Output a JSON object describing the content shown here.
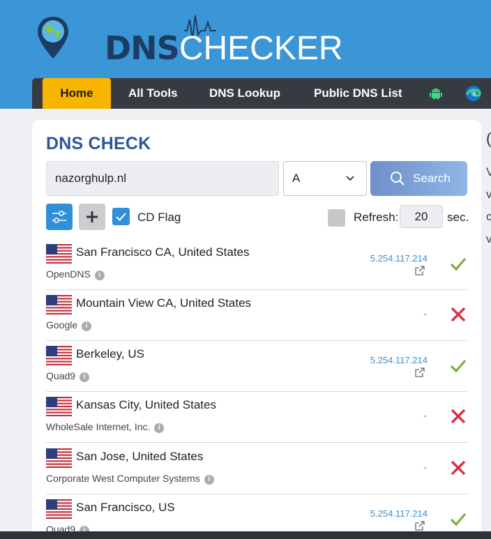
{
  "brand": {
    "logo_text_bold": "DNS",
    "logo_text_light": "CHECKER"
  },
  "nav": {
    "items": [
      {
        "label": "Home",
        "active": true
      },
      {
        "label": "All Tools"
      },
      {
        "label": "DNS Lookup"
      },
      {
        "label": "Public DNS List"
      }
    ],
    "icons": [
      "android-icon",
      "edge-icon"
    ]
  },
  "dns_check": {
    "title": "DNS CHECK",
    "domain_value": "nazorghulp.nl",
    "record_type": "A",
    "search_label": "Search",
    "cd_flag_label": "CD Flag",
    "cd_flag_checked": true,
    "refresh_label": "Refresh:",
    "refresh_value": "20",
    "refresh_unit": "sec.",
    "refresh_checked": false
  },
  "results": [
    {
      "location": "San Francisco CA, United States",
      "provider": "OpenDNS",
      "ip": "5.254.117.214",
      "status": "ok"
    },
    {
      "location": "Mountain View CA, United States",
      "provider": "Google",
      "ip": "-",
      "status": "fail"
    },
    {
      "location": "Berkeley, US",
      "provider": "Quad9",
      "ip": "5.254.117.214",
      "status": "ok"
    },
    {
      "location": "Kansas City, United States",
      "provider": "WholeSale Internet, Inc.",
      "ip": "-",
      "status": "fail"
    },
    {
      "location": "San Jose, United States",
      "provider": "Corporate West Computer Systems",
      "ip": "-",
      "status": "fail"
    },
    {
      "location": "San Francisco, US",
      "provider": "Quad9",
      "ip": "5.254.117.214",
      "status": "ok"
    }
  ],
  "colors": {
    "header_bg": "#3a96d6",
    "nav_bg": "#363b42",
    "nav_active": "#f7b500",
    "title": "#2d5796",
    "ok": "#7cad3e",
    "fail": "#d9303f",
    "link": "#3a8fd0"
  }
}
